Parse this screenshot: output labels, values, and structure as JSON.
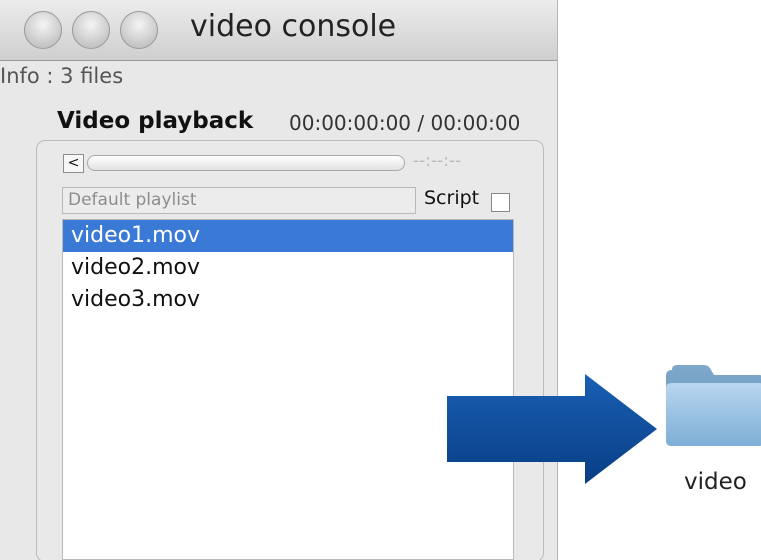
{
  "window": {
    "title": "video console",
    "info": "Info : 3 files",
    "playback_label": "Video playback",
    "timecode": "00:00:00:00 / 00:00:00",
    "back_button": "<",
    "scrub_time": "--:--:--",
    "playlist_header": "Default playlist",
    "script_label": "Script",
    "script_checked": false,
    "playlist": [
      "video1.mov",
      "video2.mov",
      "video3.mov"
    ],
    "selected_index": 0
  },
  "desktop": {
    "folder_label": "video",
    "arrow_color": "#0b4a97",
    "folder_color": "#8bb6d9"
  },
  "colors": {
    "selection": "#3a7ad6"
  }
}
